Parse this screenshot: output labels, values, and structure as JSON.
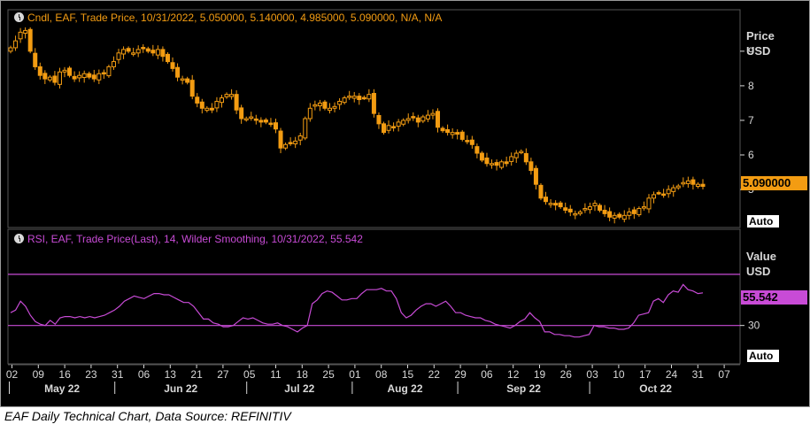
{
  "caption": "EAF Daily Technical Chart, Data Source: REFINITIV",
  "colors": {
    "price": "#f39c12",
    "rsi": "#c84bd6",
    "grid": "#555555",
    "axis_text": "#d8d8d8",
    "background": "#000000"
  },
  "chart_data": [
    {
      "type": "candlestick",
      "header": "Cndl, EAF, Trade Price, 10/31/2022, 5.050000, 5.140000, 4.985000, 5.090000, N/A, N/A",
      "ylabel": "Price",
      "yunit": "USD",
      "yticks": [
        5,
        6,
        7,
        8,
        9
      ],
      "ylim": [
        3.9,
        10.2
      ],
      "last_value_label": "5.090000",
      "autoscale_label": "Auto",
      "grid": true,
      "close": [
        9.1,
        9.3,
        9.55,
        9.6,
        9.0,
        8.55,
        8.3,
        8.2,
        8.25,
        8.1,
        8.4,
        8.45,
        8.3,
        8.2,
        8.3,
        8.35,
        8.25,
        8.2,
        8.35,
        8.35,
        8.55,
        8.7,
        8.95,
        9.05,
        9.0,
        8.95,
        9.05,
        9.1,
        9.0,
        8.95,
        9.05,
        8.85,
        8.7,
        8.5,
        8.25,
        8.2,
        8.1,
        7.7,
        7.5,
        7.35,
        7.35,
        7.3,
        7.55,
        7.65,
        7.75,
        7.75,
        7.3,
        7.05,
        7.05,
        7.1,
        7.0,
        6.95,
        6.95,
        6.9,
        6.75,
        6.2,
        6.3,
        6.35,
        6.4,
        6.55,
        7.05,
        7.35,
        7.45,
        7.5,
        7.35,
        7.35,
        7.4,
        7.55,
        7.65,
        7.7,
        7.7,
        7.6,
        7.65,
        7.75,
        7.2,
        6.9,
        6.65,
        6.85,
        6.8,
        6.95,
        7.0,
        7.05,
        7.1,
        6.95,
        7.1,
        7.15,
        7.2,
        6.8,
        6.7,
        6.65,
        6.65,
        6.6,
        6.45,
        6.4,
        6.3,
        6.05,
        5.85,
        5.75,
        5.75,
        5.7,
        5.8,
        5.75,
        5.95,
        6.05,
        6.1,
        5.8,
        5.55,
        5.15,
        4.75,
        4.65,
        4.6,
        4.55,
        4.5,
        4.4,
        4.35,
        4.3,
        4.35,
        4.45,
        4.5,
        4.6,
        4.4,
        4.3,
        4.2,
        4.25,
        4.2,
        4.25,
        4.35,
        4.3,
        4.45,
        4.5,
        4.75,
        4.85,
        4.9,
        4.85,
        5.0,
        5.05,
        5.1,
        5.2,
        5.25,
        5.15,
        5.15,
        5.09
      ]
    },
    {
      "type": "line",
      "header": "RSI, EAF, Trade Price(Last), 14, Wilder Smoothing, 10/31/2022, 55.542",
      "ylabel": "Value",
      "yunit": "USD",
      "yticks": [
        30
      ],
      "reference_lines": [
        70,
        30
      ],
      "ylim": [
        0,
        90
      ],
      "last_value_label": "55.542",
      "autoscale_label": "Auto",
      "values": [
        40,
        42,
        49,
        45,
        38,
        33,
        31,
        30,
        34,
        31,
        36,
        37,
        37,
        36,
        37,
        36,
        37,
        36,
        37,
        38,
        40,
        42,
        45,
        49,
        51,
        53,
        52,
        51,
        53,
        55,
        55,
        54,
        54,
        52,
        50,
        48,
        48,
        45,
        40,
        35,
        35,
        32,
        31,
        29,
        29,
        30,
        33,
        36,
        35,
        36,
        34,
        32,
        31,
        31,
        32,
        30,
        29,
        27,
        25,
        28,
        30,
        47,
        50,
        55,
        57,
        56,
        53,
        50,
        50,
        51,
        51,
        55,
        58,
        58,
        58,
        59,
        57,
        57,
        51,
        40,
        36,
        38,
        42,
        45,
        47,
        47,
        45,
        47,
        49,
        45,
        40,
        40,
        38,
        37,
        36,
        36,
        34,
        33,
        31,
        30,
        29,
        28,
        30,
        33,
        35,
        40,
        36,
        33,
        25,
        25,
        23,
        23,
        22,
        22,
        21,
        21,
        22,
        23,
        30,
        29,
        29,
        28,
        28,
        27,
        27,
        28,
        32,
        38,
        39,
        40,
        49,
        51,
        48,
        54,
        57,
        56,
        62,
        58,
        57,
        55,
        55.542
      ]
    }
  ],
  "x_axis": {
    "day_ticks": [
      "02",
      "09",
      "16",
      "23",
      "31",
      "06",
      "13",
      "21",
      "27",
      "05",
      "11",
      "18",
      "25",
      "01",
      "08",
      "15",
      "22",
      "29",
      "06",
      "12",
      "19",
      "26",
      "03",
      "10",
      "17",
      "24",
      "31",
      "07"
    ],
    "months": [
      "May 22",
      "Jun 22",
      "Jul 22",
      "Aug 22",
      "Sep 22",
      "Oct 22"
    ]
  }
}
